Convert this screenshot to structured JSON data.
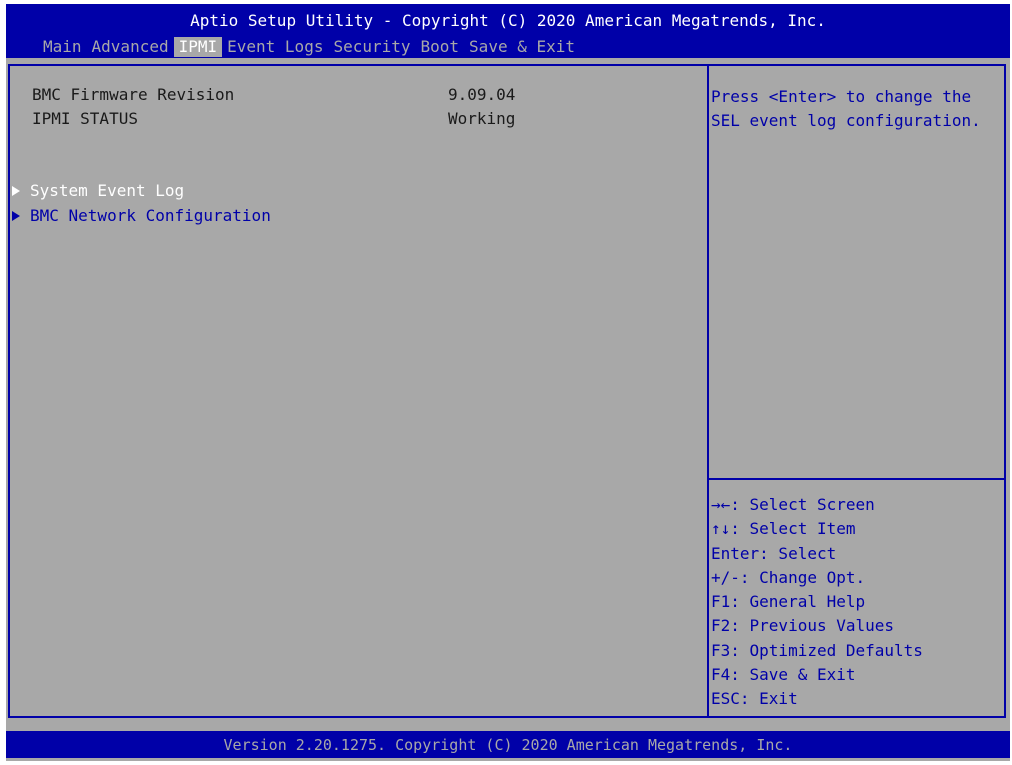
{
  "title": "Aptio Setup Utility - Copyright (C) 2020 American Megatrends, Inc.",
  "tabs": [
    {
      "label": "Main",
      "active": false
    },
    {
      "label": "Advanced",
      "active": false
    },
    {
      "label": "IPMI",
      "active": true
    },
    {
      "label": "Event Logs",
      "active": false
    },
    {
      "label": "Security",
      "active": false
    },
    {
      "label": "Boot",
      "active": false
    },
    {
      "label": "Save & Exit",
      "active": false
    }
  ],
  "info": {
    "bmc_firmware_label": "BMC Firmware Revision",
    "bmc_firmware_value": "9.09.04",
    "ipmi_status_label": "IPMI STATUS",
    "ipmi_status_value": "Working"
  },
  "submenus": [
    {
      "label": "System Event Log",
      "selected": true
    },
    {
      "label": "BMC Network Configuration",
      "selected": false
    }
  ],
  "help": {
    "line1": "Press <Enter> to change the",
    "line2": "SEL event log configuration."
  },
  "keys": [
    "→←: Select Screen",
    "↑↓: Select Item",
    "Enter: Select",
    "+/-: Change Opt.",
    "F1: General Help",
    "F2: Previous Values",
    "F3: Optimized Defaults",
    "F4: Save & Exit",
    "ESC: Exit"
  ],
  "footer": "Version 2.20.1275. Copyright (C) 2020 American Megatrends, Inc.",
  "colors": {
    "background": "#a8a8a8",
    "bar": "#0000a8",
    "highlight": "#ffffff"
  }
}
